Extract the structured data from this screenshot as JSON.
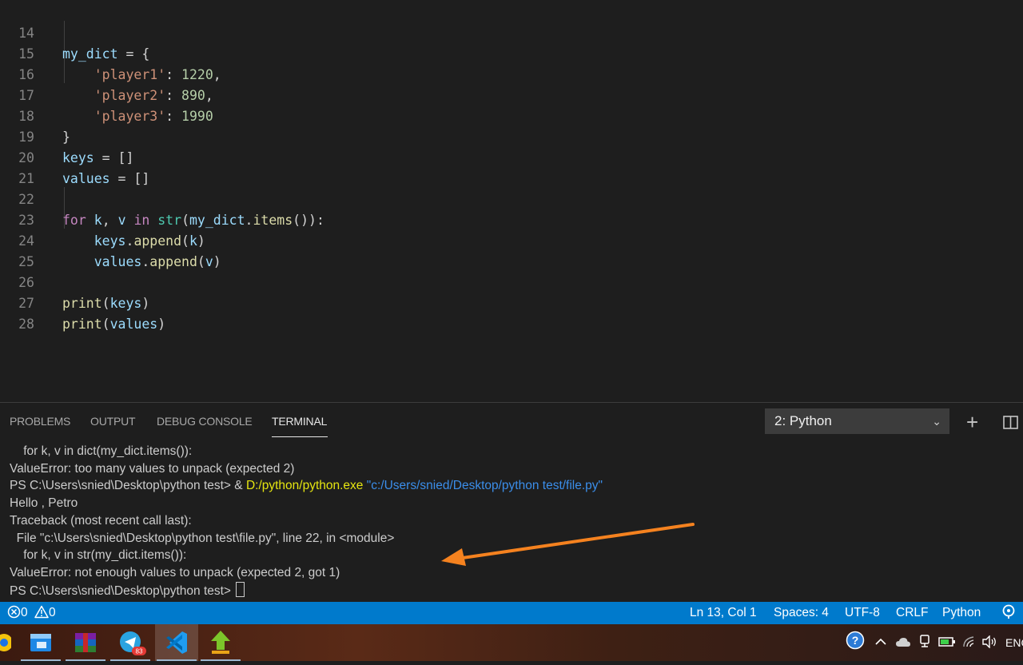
{
  "editor": {
    "lines": [
      {
        "num": "14",
        "code": "my_dict = {"
      },
      {
        "num": "15",
        "code": "    'player1': 1220,"
      },
      {
        "num": "16",
        "code": "    'player2': 890,"
      },
      {
        "num": "17",
        "code": "    'player3': 1990"
      },
      {
        "num": "18",
        "code": "}"
      },
      {
        "num": "19",
        "code": "keys = []"
      },
      {
        "num": "20",
        "code": "values = []"
      },
      {
        "num": "21",
        "code": ""
      },
      {
        "num": "22",
        "code": "for k, v in str(my_dict.items()):"
      },
      {
        "num": "23",
        "code": "    keys.append(k)"
      },
      {
        "num": "24",
        "code": "    values.append(v)"
      },
      {
        "num": "25",
        "code": ""
      },
      {
        "num": "26",
        "code": "print(keys)"
      },
      {
        "num": "27",
        "code": "print(values)"
      },
      {
        "num": "28",
        "code": ""
      }
    ]
  },
  "panel": {
    "tabs": [
      {
        "label": "PROBLEMS",
        "active": false
      },
      {
        "label": "OUTPUT",
        "active": false
      },
      {
        "label": "DEBUG CONSOLE",
        "active": false
      },
      {
        "label": "TERMINAL",
        "active": true
      }
    ],
    "terminal_select": "2: Python",
    "icons": [
      "plus-icon",
      "split-icon"
    ]
  },
  "terminal": {
    "lines": [
      "    for k, v in dict(my_dict.items()):",
      "ValueError: too many values to unpack (expected 2)",
      {
        "prompt": "PS C:\\Users\\snied\\Desktop\\python test> & ",
        "exe": "D:/python/python.exe",
        "arg": " \"c:/Users/snied/Desktop/python test/file.py\""
      },
      "Hello , Petro",
      "Traceback (most recent call last):",
      "  File \"c:\\Users\\snied\\Desktop\\python test\\file.py\", line 22, in <module>",
      "    for k, v in str(my_dict.items()):",
      "ValueError: not enough values to unpack (expected 2, got 1)",
      "PS C:\\Users\\snied\\Desktop\\python test> "
    ]
  },
  "statusbar": {
    "errors": "0",
    "warnings": "0",
    "position": "Ln 13, Col 1",
    "spaces": "Spaces: 4",
    "encoding": "UTF-8",
    "eol": "CRLF",
    "language": "Python"
  },
  "taskbar": {
    "telegram_badge": "83",
    "language": "ENG",
    "apps": [
      "chrome-icon",
      "file-explorer-icon",
      "winrar-icon",
      "telegram-icon",
      "vscode-icon",
      "green-arrow-app-icon"
    ]
  },
  "colors": {
    "statusbar": "#007acc",
    "annotation_arrow": "#f5821f"
  }
}
